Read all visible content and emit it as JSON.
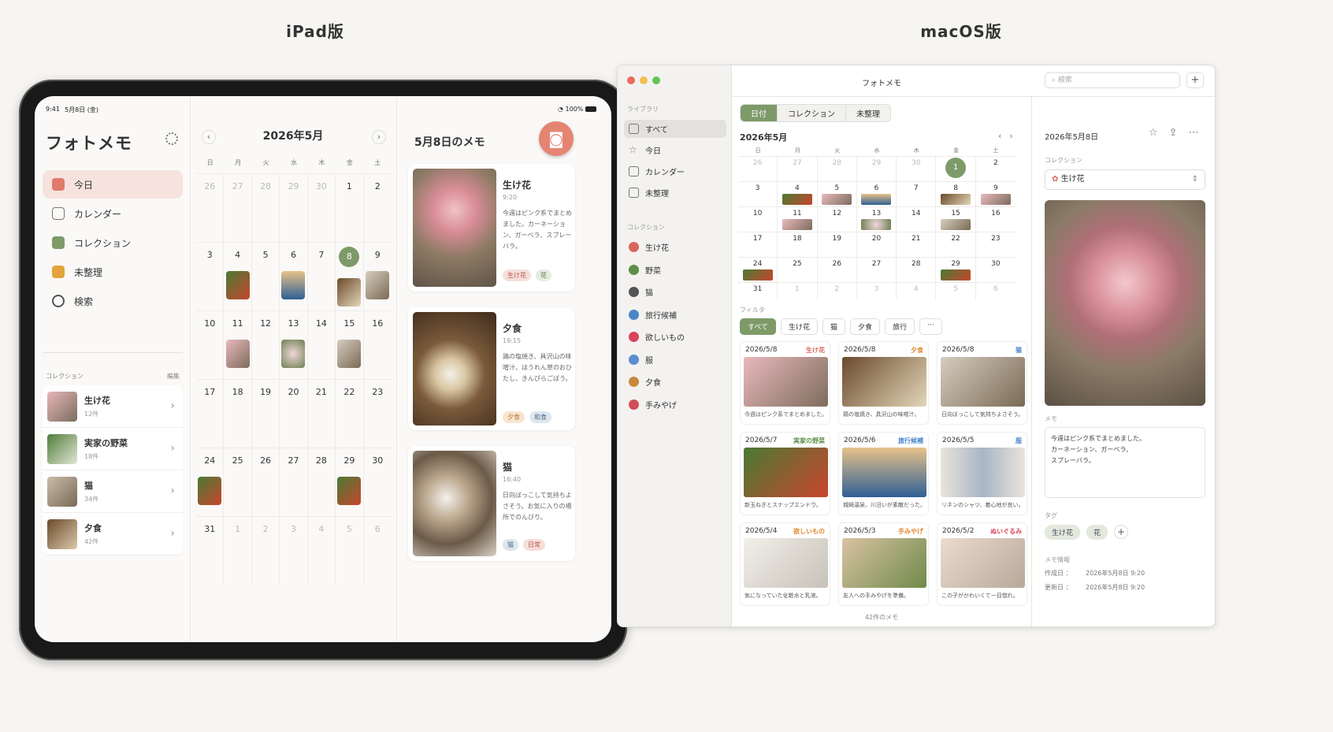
{
  "headings": {
    "ipad": "iPad版",
    "mac": "macOS版"
  },
  "ipad": {
    "status": {
      "time": "9:41",
      "date": "5月8日 (金)",
      "battery": "100%"
    },
    "app_title": "フォトメモ",
    "nav": [
      {
        "label": "今日",
        "icon": "home-icon",
        "active": true
      },
      {
        "label": "カレンダー",
        "icon": "calendar-icon"
      },
      {
        "label": "コレクション",
        "icon": "collection-icon"
      },
      {
        "label": "未整理",
        "icon": "inbox-icon"
      },
      {
        "label": "検索",
        "icon": "search-icon"
      }
    ],
    "collections_header": "コレクション",
    "edit_label": "編集",
    "collections": [
      {
        "name": "生け花",
        "count": "12件"
      },
      {
        "name": "実家の野菜",
        "count": "18件"
      },
      {
        "name": "猫",
        "count": "34件"
      },
      {
        "name": "夕食",
        "count": "42件"
      }
    ],
    "calendar": {
      "month": "2026年5月",
      "prev": "‹",
      "next": "›",
      "weekdays": [
        "日",
        "月",
        "火",
        "水",
        "木",
        "金",
        "土"
      ],
      "weeks": [
        [
          "26",
          "27",
          "28",
          "29",
          "30",
          "1",
          "2"
        ],
        [
          "3",
          "4",
          "5",
          "6",
          "7",
          "8",
          "9"
        ],
        [
          "10",
          "11",
          "12",
          "13",
          "14",
          "15",
          "16"
        ],
        [
          "17",
          "18",
          "19",
          "20",
          "21",
          "22",
          "23"
        ],
        [
          "24",
          "25",
          "26",
          "27",
          "28",
          "29",
          "30"
        ],
        [
          "31",
          "1",
          "2",
          "3",
          "4",
          "5",
          "6"
        ]
      ]
    },
    "memo": {
      "title": "5月8日のメモ",
      "add_label": "+",
      "cards": [
        {
          "title": "生け花",
          "time": "9:20",
          "text": "今週はピンク系でまとめました。カーネーション、ガーベラ、スプレーバラ。",
          "tags": [
            "生け花",
            "花"
          ]
        },
        {
          "title": "夕食",
          "time": "19:15",
          "text": "鶏の塩焼き、具沢山の味噌汁、ほうれん草のおひたし、きんぴらごぼう。",
          "tags": [
            "夕食",
            "和食"
          ]
        },
        {
          "title": "猫",
          "time": "16:40",
          "text": "日向ぼっこして気持ちよさそう。お気に入りの場所でのんびり。",
          "tags": [
            "猫",
            "日常"
          ]
        }
      ]
    }
  },
  "mac": {
    "title": "フォトメモ",
    "search_placeholder": "検索",
    "add_label": "+",
    "library_header": "ライブラリ",
    "library": [
      {
        "label": "すべて",
        "icon": "home-icon",
        "active": true
      },
      {
        "label": "今日",
        "icon": "star-icon"
      },
      {
        "label": "カレンダー",
        "icon": "calendar-icon"
      },
      {
        "label": "未整理",
        "icon": "inbox-icon"
      }
    ],
    "collections_header": "コレクション",
    "collections": [
      {
        "label": "生け花",
        "icon": "flower-icon",
        "color": "#d9665b"
      },
      {
        "label": "野菜",
        "icon": "vegetable-icon",
        "color": "#5e8e4a"
      },
      {
        "label": "猫",
        "icon": "cat-icon",
        "color": "#555555"
      },
      {
        "label": "旅行候補",
        "icon": "airplane-icon",
        "color": "#4a86c9"
      },
      {
        "label": "欲しいもの",
        "icon": "heart-icon",
        "color": "#d9435b"
      },
      {
        "label": "服",
        "icon": "shirt-icon",
        "color": "#5a8ecf"
      },
      {
        "label": "夕食",
        "icon": "fork-knife-icon",
        "color": "#c78a3b"
      },
      {
        "label": "手みやげ",
        "icon": "gift-icon",
        "color": "#d24d57"
      }
    ],
    "segments": [
      "日付",
      "コレクション",
      "未整理"
    ],
    "calendar": {
      "month": "2026年5月",
      "weekdays": [
        "日",
        "月",
        "火",
        "水",
        "木",
        "金",
        "土"
      ],
      "weeks": [
        [
          "26",
          "27",
          "28",
          "29",
          "30",
          "1",
          "2"
        ],
        [
          "3",
          "4",
          "5",
          "6",
          "7",
          "8",
          "9"
        ],
        [
          "10",
          "11",
          "12",
          "13",
          "14",
          "15",
          "16"
        ],
        [
          "17",
          "18",
          "19",
          "20",
          "21",
          "22",
          "23"
        ],
        [
          "24",
          "25",
          "26",
          "27",
          "28",
          "29",
          "30"
        ],
        [
          "31",
          "1",
          "2",
          "3",
          "4",
          "5",
          "6"
        ]
      ]
    },
    "filter_header": "フィルタ",
    "filters": [
      "すべて",
      "生け花",
      "猫",
      "夕食",
      "旅行",
      "···"
    ],
    "cards": [
      {
        "date": "2026/5/8",
        "collection": "生け花",
        "color": "#d9665b",
        "caption": "今週はピンク系でまとめました。"
      },
      {
        "date": "2026/5/8",
        "collection": "夕食",
        "color": "#e08a2e",
        "caption": "鶏の塩焼き、具沢山の味噌汁。"
      },
      {
        "date": "2026/5/8",
        "collection": "猫",
        "color": "#4a86c9",
        "caption": "日向ぼっこして気持ちよさそう。"
      },
      {
        "date": "2026/5/7",
        "collection": "実家の野菜",
        "color": "#5e8e4a",
        "caption": "新玉ねぎとスナップエンドウ。"
      },
      {
        "date": "2026/5/6",
        "collection": "旅行候補",
        "color": "#4a86c9",
        "caption": "城崎温泉、川沿いが素敵だった。"
      },
      {
        "date": "2026/5/5",
        "collection": "服",
        "color": "#4a86c9",
        "caption": "リネンのシャツ、着心地が良い。"
      },
      {
        "date": "2026/5/4",
        "collection": "欲しいもの",
        "color": "#e08a2e",
        "caption": "気になっていた化粧水と乳液。"
      },
      {
        "date": "2026/5/3",
        "collection": "手みやげ",
        "color": "#e08a2e",
        "caption": "友人への手みやげを準備。"
      },
      {
        "date": "2026/5/2",
        "collection": "ぬいぐるみ",
        "color": "#d9435b",
        "caption": "この子がかわいくて一目惚れ。"
      }
    ],
    "count_label": "42件のメモ",
    "detail": {
      "date": "2026年5月8日",
      "collection_label": "コレクション",
      "collection_value": "生け花",
      "memo_label": "メモ",
      "memo_text": "今週はピンク系でまとめました。\nカーネーション、ガーベラ、\nスプレーバラ。",
      "tags_label": "タグ",
      "tags": [
        "生け花",
        "花"
      ],
      "info_label": "メモ情報",
      "created_label": "作成日 ：",
      "created": "2026年5月8日 9:20",
      "updated_label": "更新日 ：",
      "updated": "2026年5月8日 9:20"
    }
  }
}
